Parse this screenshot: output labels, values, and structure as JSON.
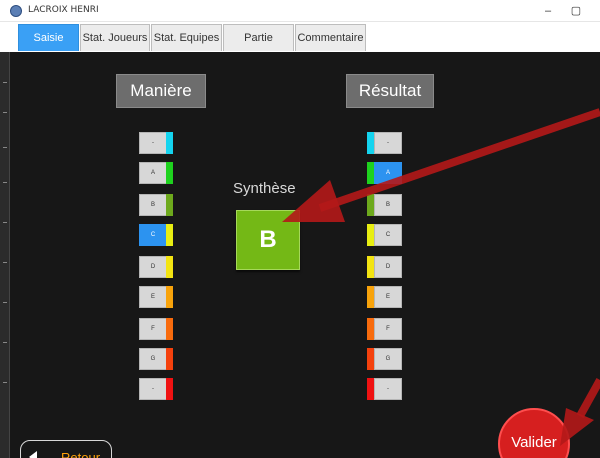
{
  "window": {
    "title": "LACROIX HENRI",
    "minimize_glyph": "–",
    "maximize_glyph": "▢",
    "icon": "app-logo-icon"
  },
  "tabs": [
    {
      "label": "Saisie",
      "active": true
    },
    {
      "label": "Stat. Joueurs",
      "active": false
    },
    {
      "label": "Stat. Equipes",
      "active": false
    },
    {
      "label": "Partie",
      "active": false
    },
    {
      "label": "Commentaire",
      "active": false
    }
  ],
  "maniere": {
    "title": "Manière",
    "items": [
      {
        "label": "-",
        "color": "#14d4ef",
        "selected": false
      },
      {
        "label": "A",
        "color": "#1ed21e",
        "selected": false
      },
      {
        "label": "B",
        "color": "#6da91c",
        "selected": false
      },
      {
        "label": "C",
        "color": "#e8ee12",
        "selected": true
      },
      {
        "label": "D",
        "color": "#f3e412",
        "selected": false
      },
      {
        "label": "E",
        "color": "#f8a30b",
        "selected": false
      },
      {
        "label": "F",
        "color": "#f86b0d",
        "selected": false
      },
      {
        "label": "G",
        "color": "#f4410d",
        "selected": false
      },
      {
        "label": "-",
        "color": "#ef1212",
        "selected": false
      }
    ]
  },
  "resultat": {
    "title": "Résultat",
    "items": [
      {
        "label": "-",
        "color": "#14d4ef",
        "selected": false
      },
      {
        "label": "A",
        "color": "#1ed21e",
        "selected": true
      },
      {
        "label": "B",
        "color": "#6da91c",
        "selected": false
      },
      {
        "label": "C",
        "color": "#e8ee12",
        "selected": false
      },
      {
        "label": "D",
        "color": "#f3e412",
        "selected": false
      },
      {
        "label": "E",
        "color": "#f8a30b",
        "selected": false
      },
      {
        "label": "F",
        "color": "#f86b0d",
        "selected": false
      },
      {
        "label": "G",
        "color": "#f4410d",
        "selected": false
      },
      {
        "label": "-",
        "color": "#ef1212",
        "selected": false
      }
    ]
  },
  "synthese": {
    "label": "Synthèse",
    "value": "B",
    "color": "#74b816"
  },
  "valider": {
    "label": "Valider",
    "color": "#d61f1f"
  },
  "retour": {
    "label": "Retour",
    "icon": "arrow-left-icon"
  },
  "colors": {
    "accent": "#3aa0f5",
    "background": "#171717",
    "annotation_arrow": "#b41818"
  }
}
